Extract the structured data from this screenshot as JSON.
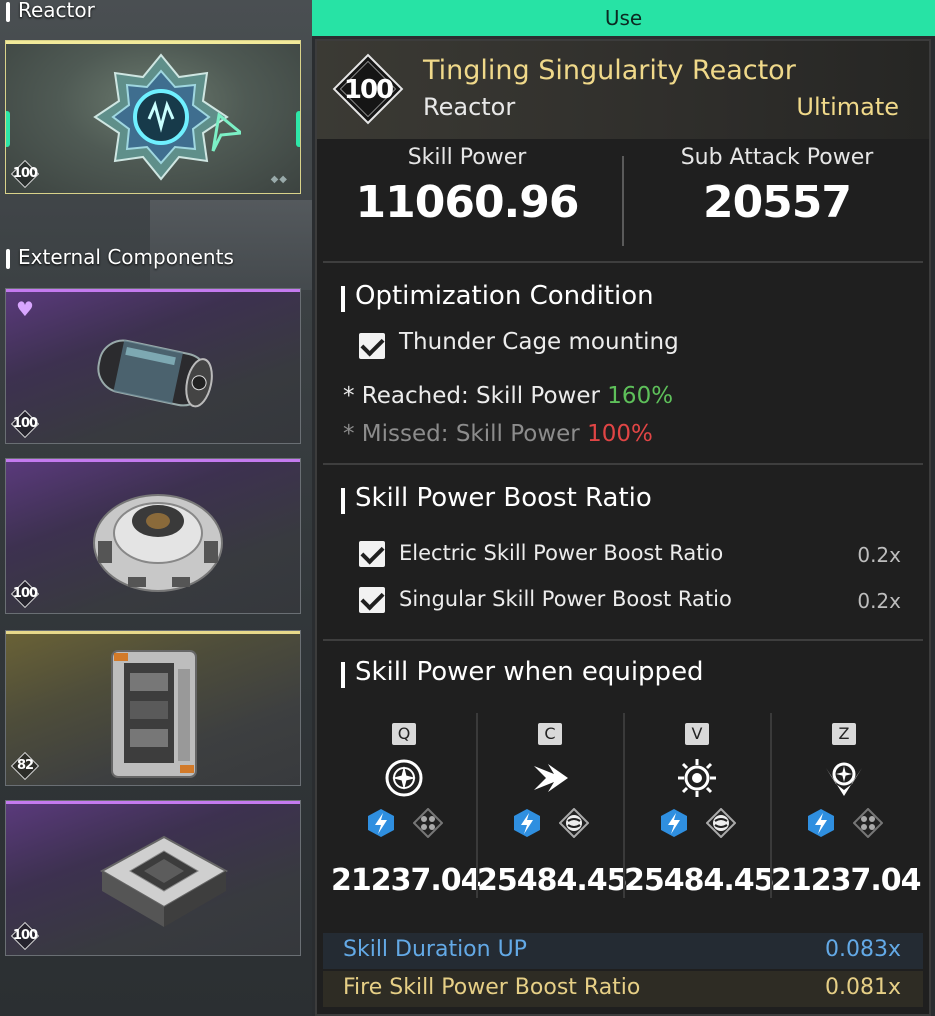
{
  "left": {
    "reactor_label": "Reactor",
    "external_label": "External Components",
    "reactor_card": {
      "level": "100"
    },
    "components": [
      {
        "level": "100",
        "color": "purple"
      },
      {
        "level": "100",
        "color": "purple"
      },
      {
        "level": "82",
        "color": "gold"
      },
      {
        "level": "100",
        "color": "purple"
      }
    ]
  },
  "use_label": "Use",
  "item": {
    "level": "100",
    "name": "Tingling Singularity Reactor",
    "type": "Reactor",
    "grade": "Ultimate"
  },
  "stats": {
    "skill_power_label": "Skill Power",
    "skill_power_value": "11060.96",
    "sub_attack_label": "Sub Attack Power",
    "sub_attack_value": "20557"
  },
  "optimization": {
    "title": "Optimization Condition",
    "condition": "Thunder Cage mounting",
    "reached_prefix": "* Reached: Skill Power",
    "reached_value": "160%",
    "missed_prefix": "* Missed: Skill Power",
    "missed_value": "100%"
  },
  "boost": {
    "title": "Skill Power Boost Ratio",
    "items": [
      {
        "label": "Electric Skill Power Boost Ratio",
        "value": "0.2x"
      },
      {
        "label": "Singular Skill Power Boost Ratio",
        "value": "0.2x"
      }
    ]
  },
  "equipped": {
    "title": "Skill Power when equipped",
    "skills": [
      {
        "key": "Q",
        "value": "21237.04",
        "icon": "target-skill-icon"
      },
      {
        "key": "C",
        "value": "25484.45",
        "icon": "arrow-burst-skill-icon"
      },
      {
        "key": "V",
        "value": "25484.45",
        "icon": "sun-burst-skill-icon"
      },
      {
        "key": "Z",
        "value": "21237.04",
        "icon": "crest-skill-icon"
      }
    ]
  },
  "bonuses": [
    {
      "label": "Skill Duration UP",
      "value": "0.083x",
      "color": "#63a9e6"
    },
    {
      "label": "Fire Skill Power Boost Ratio",
      "value": "0.081x",
      "color": "#e6cf86"
    }
  ],
  "colors": {
    "accent": "#27e3a5",
    "gold": "#f0d98a",
    "electric": "#2f8fe0"
  }
}
